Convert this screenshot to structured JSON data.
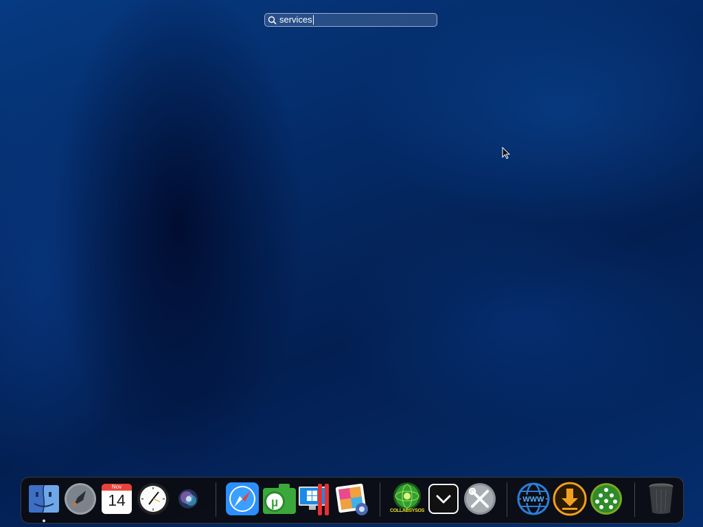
{
  "search": {
    "value": "services",
    "icon": "magnifying-glass-icon"
  },
  "cursor": {
    "icon": "arrow-pointer-icon"
  },
  "dock": {
    "apps": [
      {
        "name": "finder-icon",
        "running": true
      },
      {
        "name": "launchpad-icon",
        "running": false
      },
      {
        "name": "calendar-icon",
        "month": "Nov",
        "day": "14"
      },
      {
        "name": "clock-icon"
      },
      {
        "name": "siri-icon"
      },
      {
        "name": "safari-icon"
      },
      {
        "name": "utorrent-icon"
      },
      {
        "name": "parallels-windows-icon"
      },
      {
        "name": "image-capture-icon"
      },
      {
        "name": "collabsysos-icon",
        "label": "COLLABSYSOS"
      },
      {
        "name": "chevron-down-icon"
      },
      {
        "name": "tools-icon"
      },
      {
        "name": "www-globe-icon"
      },
      {
        "name": "download-arrow-icon"
      },
      {
        "name": "network-group-icon"
      },
      {
        "name": "trash-icon"
      }
    ]
  },
  "colors": {
    "accent": "#2b8fff",
    "calendar_red": "#e8423a",
    "download_orange": "#f0a020",
    "globe_blue": "#2a7fd8",
    "collab_green": "#2fa030"
  }
}
